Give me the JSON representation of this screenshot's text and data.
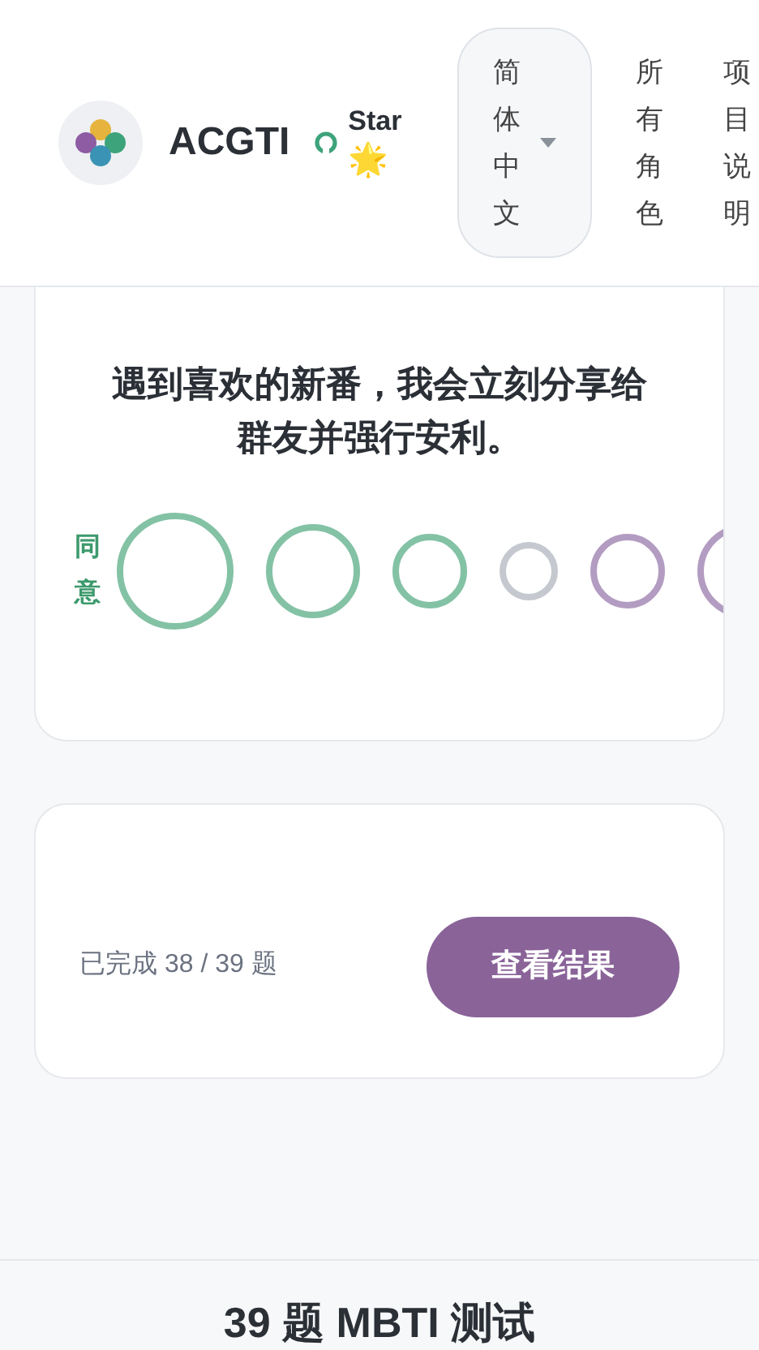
{
  "header": {
    "brand": "ACGTI",
    "github": {
      "label": "Star",
      "emoji": "🌟"
    },
    "language": {
      "value": "简体中文"
    },
    "nav": [
      {
        "label": "所有角色"
      },
      {
        "label": "项目说明"
      }
    ]
  },
  "question": {
    "text": "遇到喜欢的新番，我会立刻分享给群友并强行安利。",
    "agree_label": "同意",
    "options": [
      {
        "kind": "agree",
        "selected": false
      },
      {
        "kind": "agree",
        "selected": false
      },
      {
        "kind": "agree",
        "selected": false
      },
      {
        "kind": "neutral",
        "selected": false
      },
      {
        "kind": "disagree",
        "selected": false
      },
      {
        "kind": "disagree",
        "selected": false
      }
    ]
  },
  "progress": {
    "text": "已完成 38 / 39 题",
    "button": "查看结果"
  },
  "footer": {
    "heading": "39 题 MBTI 测试"
  }
}
